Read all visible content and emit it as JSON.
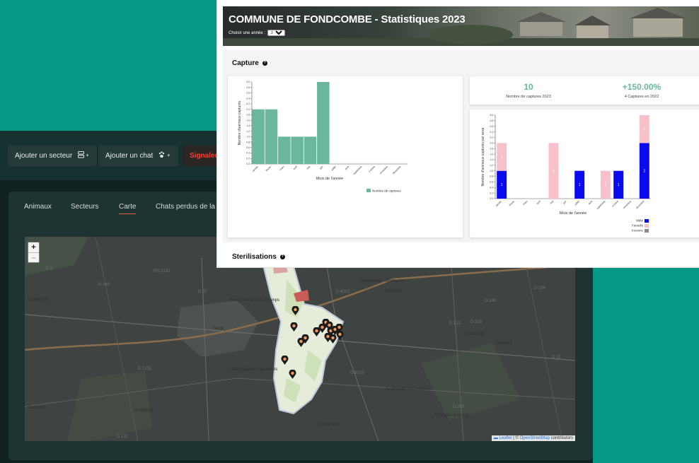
{
  "toolbar": {
    "add_sector": "Ajouter un secteur",
    "add_sector_icon": "server-plus-icon",
    "add_cat": "Ajouter un chat",
    "add_cat_icon": "paw-plus-icon",
    "report": "Signalem"
  },
  "tabs": [
    "Animaux",
    "Secteurs",
    "Carte",
    "Chats perdus de la co"
  ],
  "active_tab": "Carte",
  "map": {
    "zoom_in": "+",
    "zoom_out": "–",
    "attribution_flag": "Leaflet",
    "attribution_sep": "| ©",
    "attribution_link": "OpenStreetMap",
    "attribution_tail": "contributors",
    "places": [
      "Yvetot",
      "Sainte-Marie-des-Champs",
      "Saint-Clair-sur-les-Monts",
      "Ecretteville",
      "Ouainville",
      "Valliquerville",
      "Auzebosc",
      "Motteville",
      "Etoutteville",
      "Fontaine-le-Bourg",
      "Flamanville",
      "Touffreville-la-Corbeline",
      "Allouville",
      "Dlcarme"
    ],
    "road_labels": [
      "D 5",
      "D 240",
      "RN 2131",
      "D 37",
      "D 6015",
      "D 6015",
      "D 131",
      "D 1215",
      "D 131",
      "D 104",
      "D 263",
      "D 203",
      "D 22",
      "D 240"
    ]
  },
  "stats": {
    "title": "COMMUNE DE FONDCOMBE - Statistiques 2023",
    "year_label": "Choisir une année :",
    "year_value": "2023",
    "capture_title": "Capture",
    "captures_total": "10",
    "captures_total_label": "Nombre de captures 2023",
    "captures_change": "+150.00%",
    "captures_change_label": "4 Captures en 2022",
    "sterilisations_title": "Sterilisations"
  },
  "chart_data": [
    {
      "type": "bar",
      "title": "",
      "xlabel": "Mois de l'année",
      "ylabel": "Nombre d'animaux capturés",
      "ylim": [
        0,
        3.0
      ],
      "categories": [
        "janvier",
        "février",
        "mars",
        "avril",
        "mai",
        "juin",
        "juillet",
        "août",
        "septembre",
        "octobre",
        "novembre",
        "décembre"
      ],
      "series": [
        {
          "name": "Nombre de captures",
          "color": "#6ab79c",
          "values": [
            2,
            2,
            1,
            1,
            1,
            3,
            0,
            0,
            0,
            0,
            0,
            0
          ]
        }
      ],
      "legend": "bottom-right"
    },
    {
      "type": "bar",
      "stacked": true,
      "title": "",
      "xlabel": "Mois de l'année",
      "ylabel": "Nombre d'animaux capturés par sexe",
      "ylim": [
        0,
        3.0
      ],
      "categories": [
        "janvier",
        "février",
        "mars",
        "avril",
        "mai",
        "juin",
        "juillet",
        "août",
        "septembre",
        "octobre",
        "novembre",
        "décembre"
      ],
      "series": [
        {
          "name": "Mâle",
          "color": "#0a0aee",
          "values": [
            1,
            0,
            0,
            0,
            0,
            0,
            1,
            0,
            0,
            1,
            0,
            2
          ]
        },
        {
          "name": "Femelle",
          "color": "#f7c0cb",
          "values": [
            1,
            0,
            0,
            0,
            2,
            0,
            0,
            0,
            1,
            0,
            0,
            1
          ]
        },
        {
          "name": "Inconnu",
          "color": "#8a8a8a",
          "values": [
            0,
            0,
            0,
            0,
            0,
            0,
            0,
            0,
            0,
            0,
            0,
            0
          ]
        }
      ],
      "legend": "bottom-right"
    }
  ]
}
